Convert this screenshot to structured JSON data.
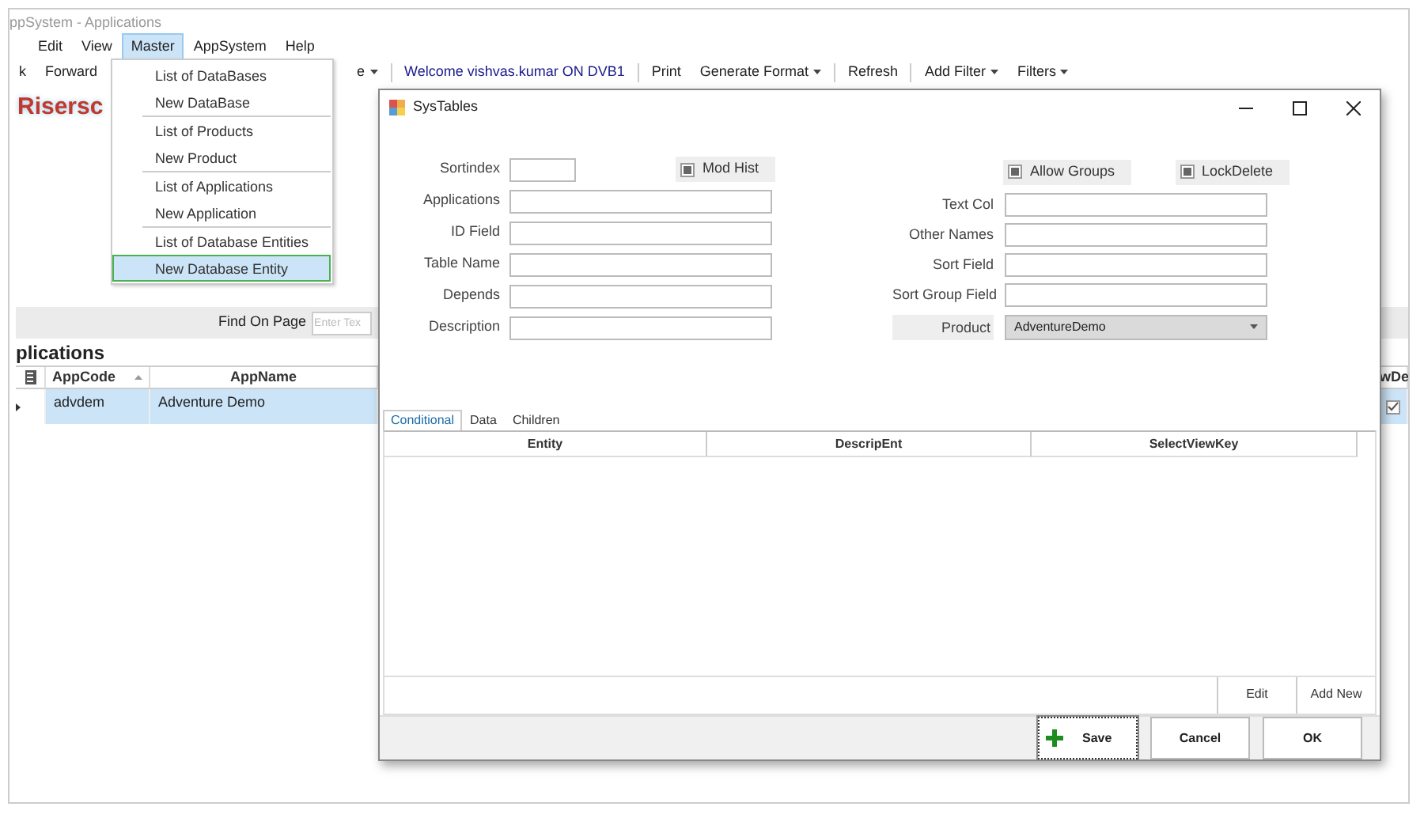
{
  "window": {
    "title": "ppSystem - Applications"
  },
  "menu_bar": [
    {
      "label": "Edit",
      "selected": false
    },
    {
      "label": "View",
      "selected": false
    },
    {
      "label": "Master",
      "selected": true
    },
    {
      "label": "AppSystem",
      "selected": false
    },
    {
      "label": "Help",
      "selected": false
    }
  ],
  "toolbar": [
    {
      "kind": "button",
      "label": "k"
    },
    {
      "kind": "button",
      "label": "Forward"
    },
    {
      "kind": "dropdown",
      "label": "e"
    },
    {
      "kind": "separator"
    },
    {
      "kind": "welcome",
      "label": "Welcome vishvas.kumar ON DVB1"
    },
    {
      "kind": "separator"
    },
    {
      "kind": "button",
      "label": "Print"
    },
    {
      "kind": "dropdown",
      "label": "Generate Format"
    },
    {
      "kind": "separator"
    },
    {
      "kind": "button",
      "label": "Refresh"
    },
    {
      "kind": "separator"
    },
    {
      "kind": "dropdown",
      "label": "Add Filter"
    },
    {
      "kind": "dropdown",
      "label": "Filters"
    }
  ],
  "logo": "Risersc",
  "search": {
    "label": "Find On Page",
    "placeholder": "Enter Tex"
  },
  "section_title": "plications",
  "grid": {
    "columns": [
      {
        "label": "AppCode",
        "sorted": true
      },
      {
        "label": "AppName",
        "sorted": false
      },
      {
        "label": "wDe",
        "sorted": false
      }
    ],
    "rows": [
      {
        "cells": [
          "advdem",
          "Adventure Demo"
        ],
        "selected": true,
        "checked": true
      }
    ]
  },
  "master_menu": [
    [
      {
        "label": "List of DataBases",
        "selected": false
      },
      {
        "label": "New DataBase",
        "selected": false
      }
    ],
    [
      {
        "label": "List of Products",
        "selected": false
      },
      {
        "label": "New Product",
        "selected": false
      }
    ],
    [
      {
        "label": "List of Applications",
        "selected": false
      },
      {
        "label": "New Application",
        "selected": false
      }
    ],
    [
      {
        "label": "List of Database Entities",
        "selected": false
      },
      {
        "label": "New Database Entity",
        "selected": true
      }
    ]
  ],
  "dialog": {
    "title": "SysTables",
    "left_fields": [
      {
        "label": "Sortindex",
        "kind": "short"
      },
      {
        "label": "Applications",
        "kind": "text"
      },
      {
        "label": "ID Field",
        "kind": "text"
      },
      {
        "label": "Table Name",
        "kind": "text"
      },
      {
        "label": "Depends",
        "kind": "text"
      },
      {
        "label": "Description",
        "kind": "text"
      }
    ],
    "mod_hist": {
      "label": "Mod Hist",
      "indeterminate": true
    },
    "flags": [
      {
        "label": "Allow Groups",
        "indeterminate": true
      },
      {
        "label": "LockDelete",
        "indeterminate": true
      }
    ],
    "right_fields": [
      {
        "label": "Text Col",
        "kind": "text"
      },
      {
        "label": "Other Names",
        "kind": "text"
      },
      {
        "label": "Sort Field",
        "kind": "text"
      },
      {
        "label": "Sort Group Field",
        "kind": "text"
      },
      {
        "label": "Product",
        "kind": "dropdown",
        "value": "AdventureDemo"
      }
    ],
    "tabs": [
      {
        "label": "Conditional",
        "selected": true
      },
      {
        "label": "Data",
        "selected": false
      },
      {
        "label": "Children",
        "selected": false
      }
    ],
    "columns": [
      "Entity",
      "DescripEnt",
      "SelectViewKey"
    ],
    "grid_buttons": [
      "Edit",
      "Add New"
    ],
    "buttons": [
      {
        "label": "Save",
        "kind": "save",
        "focused": true
      },
      {
        "label": "Cancel",
        "kind": "plain",
        "focused": false
      },
      {
        "label": "OK",
        "kind": "plain",
        "focused": false
      }
    ]
  }
}
